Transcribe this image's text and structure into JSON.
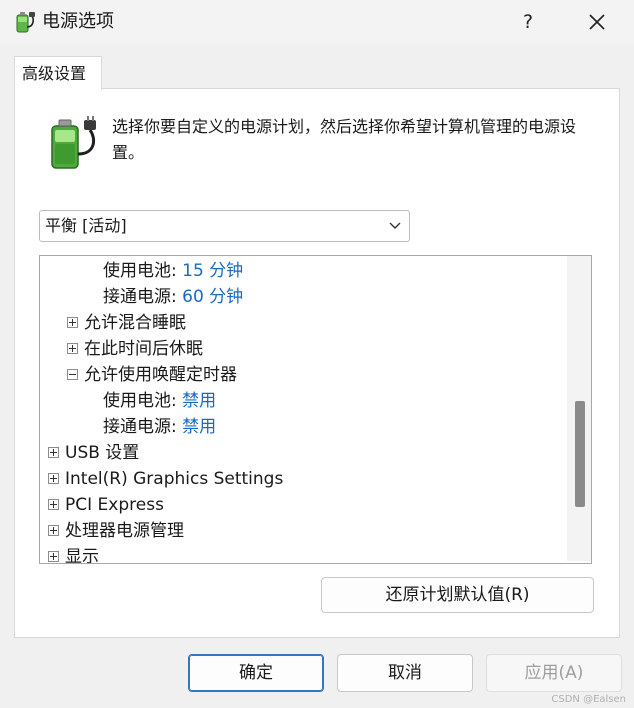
{
  "window": {
    "title": "电源选项",
    "help_label": "?",
    "icons": {
      "app": "battery-plug-icon",
      "close": "close-icon"
    }
  },
  "tab": {
    "label": "高级设置"
  },
  "intro": {
    "text": "选择你要自定义的电源计划，然后选择你希望计算机管理的电源设置。"
  },
  "plan_select": {
    "value": "平衡 [活动]"
  },
  "tree": {
    "items": [
      {
        "label": "使用电池: ",
        "value": "15 分钟",
        "expander": ""
      },
      {
        "label": "接通电源: ",
        "value": "60 分钟",
        "expander": ""
      },
      {
        "label": "允许混合睡眠",
        "value": "",
        "expander": "plus"
      },
      {
        "label": "在此时间后休眠",
        "value": "",
        "expander": "plus"
      },
      {
        "label": "允许使用唤醒定时器",
        "value": "",
        "expander": "minus"
      },
      {
        "label": "使用电池: ",
        "value": "禁用",
        "expander": ""
      },
      {
        "label": "接通电源: ",
        "value": "禁用",
        "expander": ""
      },
      {
        "label": "USB 设置",
        "value": "",
        "expander": "plus"
      },
      {
        "label": "Intel(R) Graphics Settings",
        "value": "",
        "expander": "plus"
      },
      {
        "label": "PCI Express",
        "value": "",
        "expander": "plus"
      },
      {
        "label": "处理器电源管理",
        "value": "",
        "expander": "plus"
      },
      {
        "label": "显示",
        "value": "",
        "expander": "plus"
      }
    ]
  },
  "buttons": {
    "restore": "还原计划默认值(R)",
    "ok": "确定",
    "cancel": "取消",
    "apply": "应用(A)"
  },
  "watermark": "CSDN @Ealsen"
}
